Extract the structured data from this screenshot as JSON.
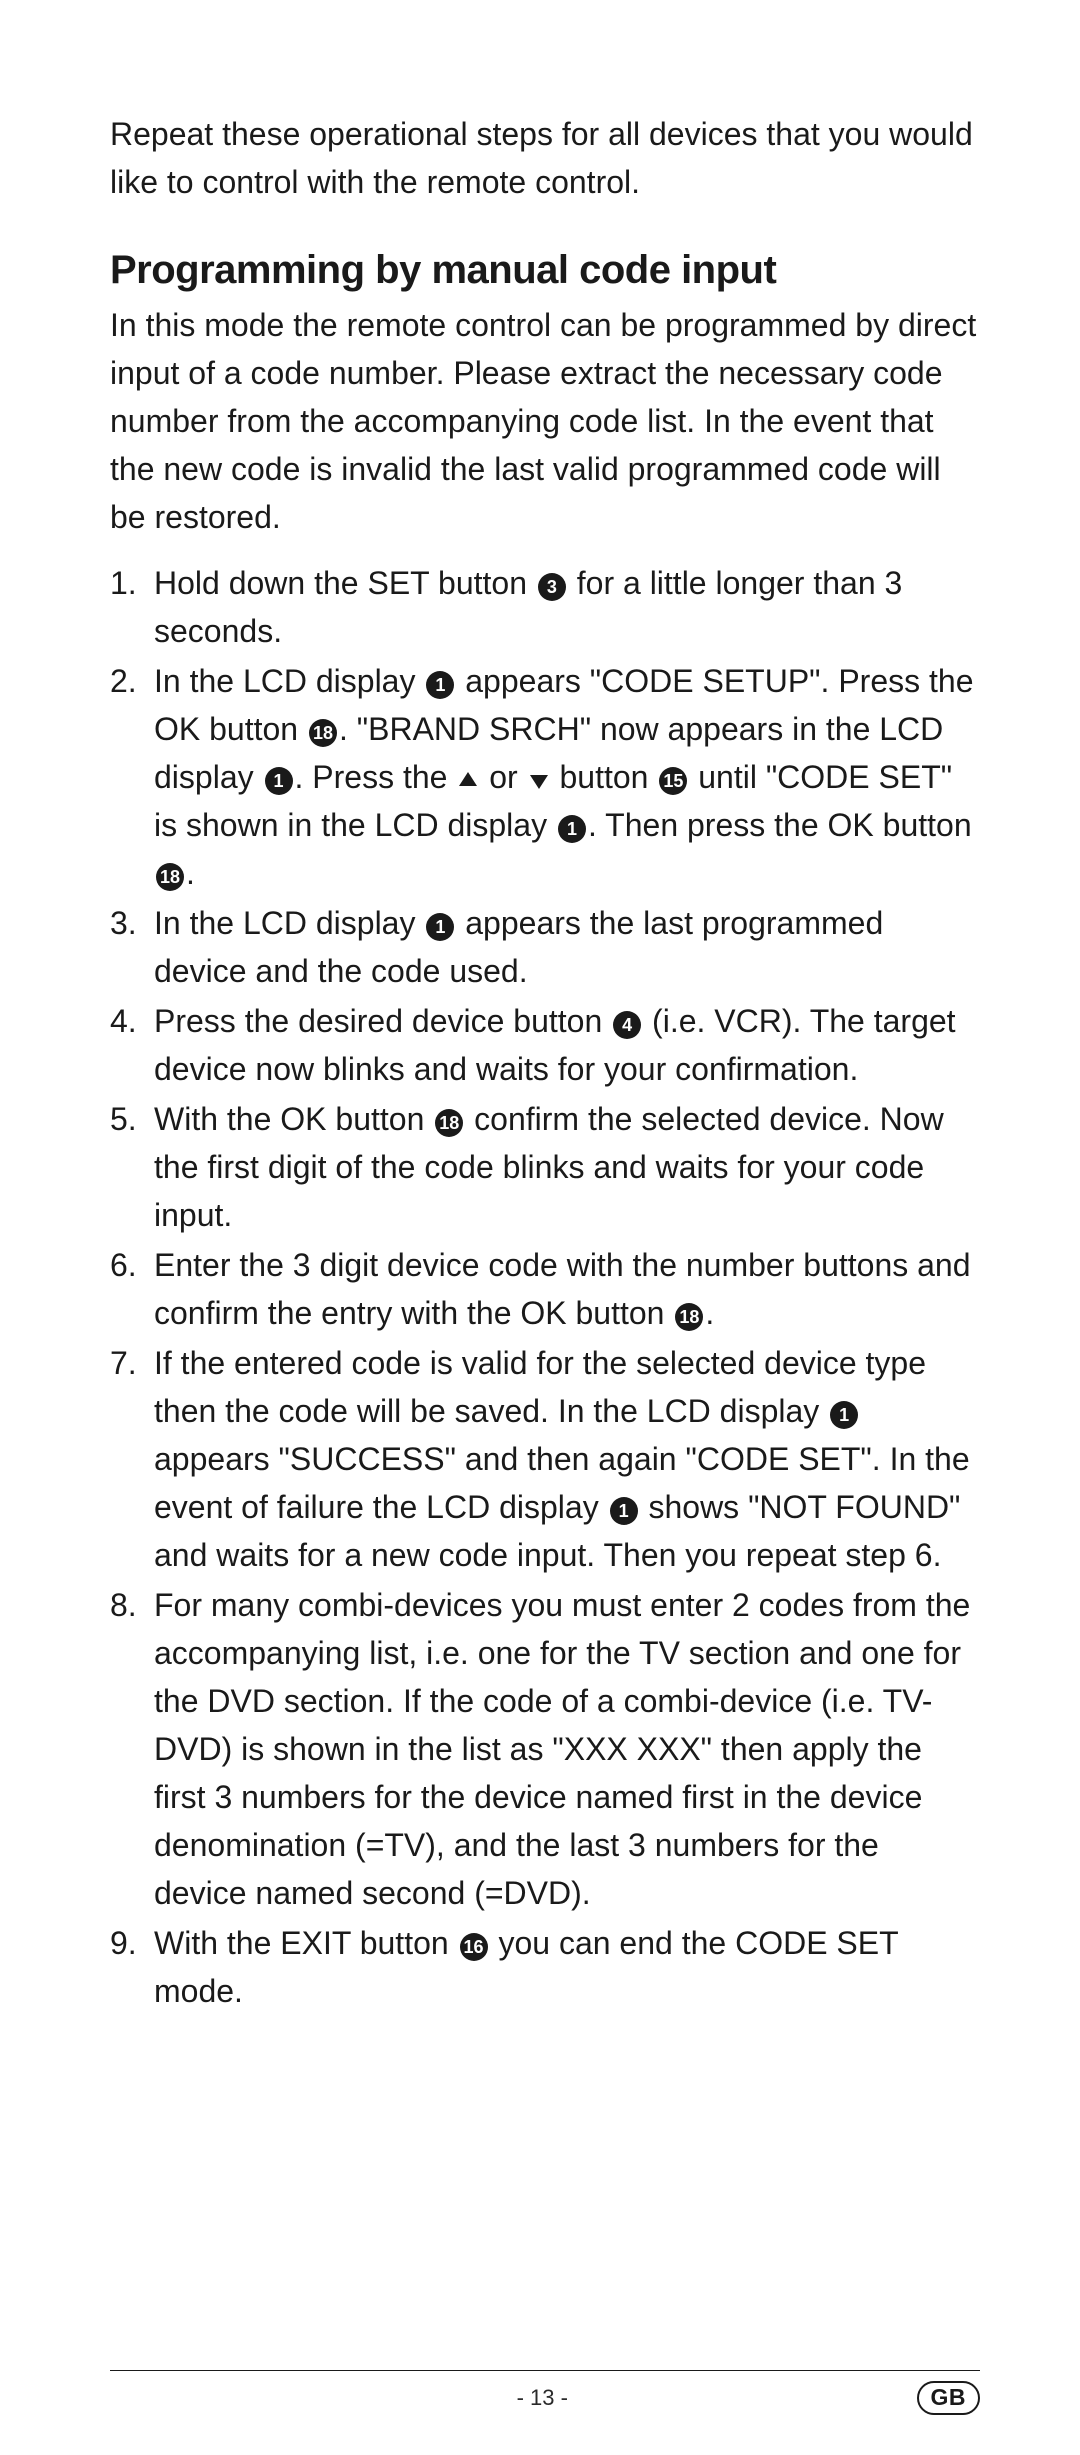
{
  "intro": "Repeat these operational steps for all devices that you would like to control with the remote control.",
  "heading": "Programming by manual code input",
  "para": "In this mode the remote control can be programmed by direct input of a code number. Please extract the necessary code number from the accompanying code list. In the event that the new code is invalid the last valid programmed code will be restored.",
  "steps": {
    "s1_a": "Hold down the SET button ",
    "s1_b": " for a little longer than 3 seconds.",
    "s2_a": "In the LCD display ",
    "s2_b": " appears \"CODE SETUP\". Press the OK button ",
    "s2_c": ". \"BRAND SRCH\" now appears in the LCD display ",
    "s2_d": ". Press the ",
    "s2_e": " or ",
    "s2_f": " button ",
    "s2_g": " until \"CODE SET\" is shown in the LCD display ",
    "s2_h": ". Then press the OK button ",
    "s2_i": ".",
    "s3_a": "In the LCD display ",
    "s3_b": " appears the last programmed device and the code used.",
    "s4_a": "Press the desired device button ",
    "s4_b": " (i.e. VCR). The target device now blinks and waits for your confirmation.",
    "s5_a": "With the OK button ",
    "s5_b": " confirm the selected device. Now the first digit of the code blinks and waits for your code input.",
    "s6_a": "Enter the 3 digit device code with the number buttons and confirm the entry with the OK button ",
    "s6_b": ".",
    "s7_a": "If the entered code is valid for the selected device type then the code will be saved. In the LCD display ",
    "s7_b": " appears \"SUCCESS\" and then again \"CODE SET\". In the event of failure the LCD display ",
    "s7_c": " shows \"NOT FOUND\" and waits for a new code input. Then you repeat step 6.",
    "s8": "For many combi-devices you must enter 2 codes from the accompanying list, i.e. one for the TV section and one for the DVD section. If the code of a combi-device (i.e. TV-DVD) is shown in the list as \"XXX XXX\" then apply the first 3 numbers for the device named first in the device denomination (=TV), and the last 3 numbers for the device named second (=DVD).",
    "s9_a": "With the EXIT button ",
    "s9_b": " you can end the CODE SET mode."
  },
  "refs": {
    "r1": "1",
    "r3": "3",
    "r4": "4",
    "r15": "15",
    "r16": "16",
    "r18": "18"
  },
  "footer": {
    "page": "- 13 -",
    "region": "GB"
  }
}
